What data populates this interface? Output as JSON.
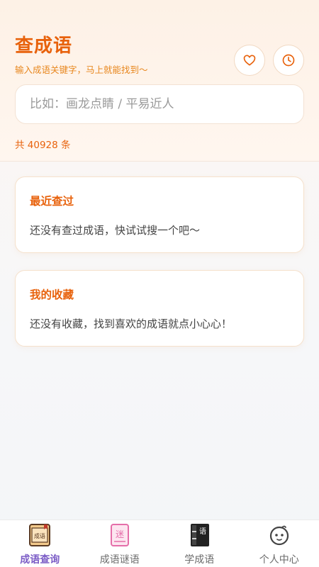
{
  "header": {
    "title": "查成语",
    "subtitle": "输入成语关键字，马上就能找到～",
    "favorite_icon": "heart-icon",
    "history_icon": "clock-icon"
  },
  "search": {
    "placeholder": "比如：画龙点睛 / 平易近人",
    "value": ""
  },
  "result_count": "共 40928 条",
  "sections": [
    {
      "title": "最近查过",
      "empty_text": "还没有查过成语，快试试搜一个吧～"
    },
    {
      "title": "我的收藏",
      "empty_text": "还没有收藏，找到喜欢的成语就点小心心！"
    }
  ],
  "tabbar": {
    "items": [
      {
        "label": "成语查询",
        "icon": "book-icon",
        "active": true,
        "icon_text": "成语"
      },
      {
        "label": "成语谜语",
        "icon": "riddle-icon",
        "active": false,
        "icon_text": "迷"
      },
      {
        "label": "学成语",
        "icon": "notebook-icon",
        "active": false,
        "icon_text": "语"
      },
      {
        "label": "个人中心",
        "icon": "face-icon",
        "active": false
      }
    ]
  },
  "colors": {
    "accent": "#e8620c",
    "active_tab": "#7b5cc6"
  }
}
